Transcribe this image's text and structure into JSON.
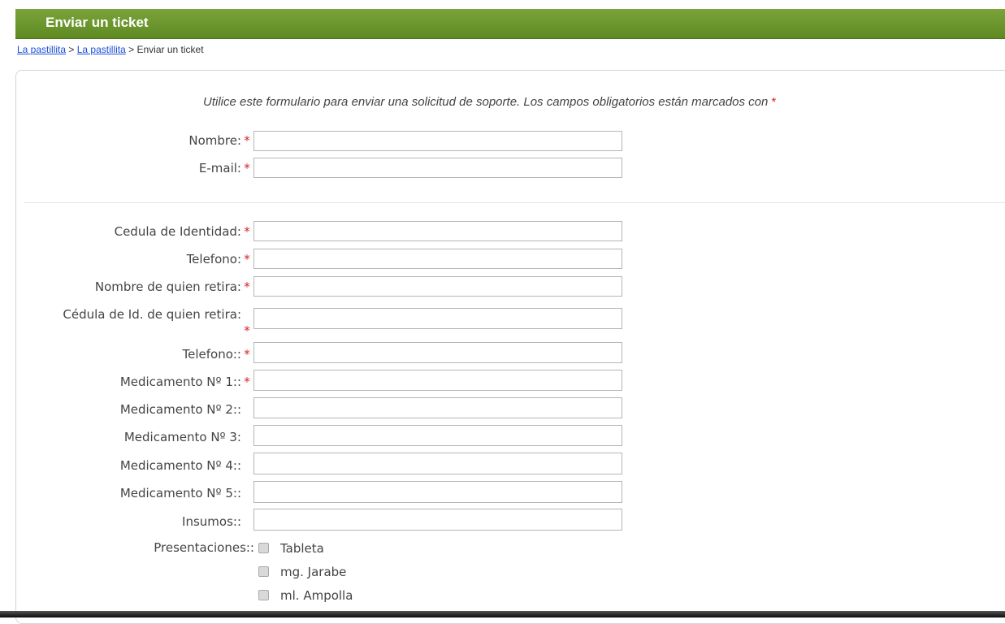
{
  "title": "Enviar un ticket",
  "breadcrumb": {
    "link1": "La pastillita",
    "sep1": ">",
    "link2": "La pastillita",
    "sep2": ">",
    "current": "Enviar un ticket"
  },
  "intro": "Utilice este formulario para enviar una solicitud de soporte. Los campos obligatorios están marcados con",
  "required_mark": "*",
  "fields": {
    "nombre": {
      "label": "Nombre:",
      "value": "",
      "required": true
    },
    "email": {
      "label": "E-mail:",
      "value": "",
      "required": true
    },
    "cedula": {
      "label": "Cedula de Identidad:",
      "value": "",
      "required": true
    },
    "telefono": {
      "label": "Telefono:",
      "value": "",
      "required": true
    },
    "nombre_retira": {
      "label": "Nombre de quien retira:",
      "value": "",
      "required": true
    },
    "cedula_retira": {
      "label": "Cédula de Id. de quien retira:",
      "value": "",
      "required": true
    },
    "telefono2": {
      "label": "Telefono::",
      "value": "",
      "required": true
    },
    "med1": {
      "label": "Medicamento Nº 1::",
      "value": "",
      "required": true
    },
    "med2": {
      "label": "Medicamento Nº 2::",
      "value": "",
      "required": false
    },
    "med3": {
      "label": "Medicamento Nº 3:",
      "value": "",
      "required": false
    },
    "med4": {
      "label": "Medicamento Nº 4::",
      "value": "",
      "required": false
    },
    "med5": {
      "label": "Medicamento Nº 5::",
      "value": "",
      "required": false
    },
    "insumos": {
      "label": "Insumos::",
      "value": "",
      "required": false
    }
  },
  "presentaciones": {
    "label": "Presentaciones::",
    "options": [
      "Tableta",
      "mg. Jarabe",
      "ml. Ampolla"
    ]
  },
  "colors": {
    "title_bar": "#6b962c",
    "link": "#1a4fd6",
    "required": "#dd2222"
  }
}
